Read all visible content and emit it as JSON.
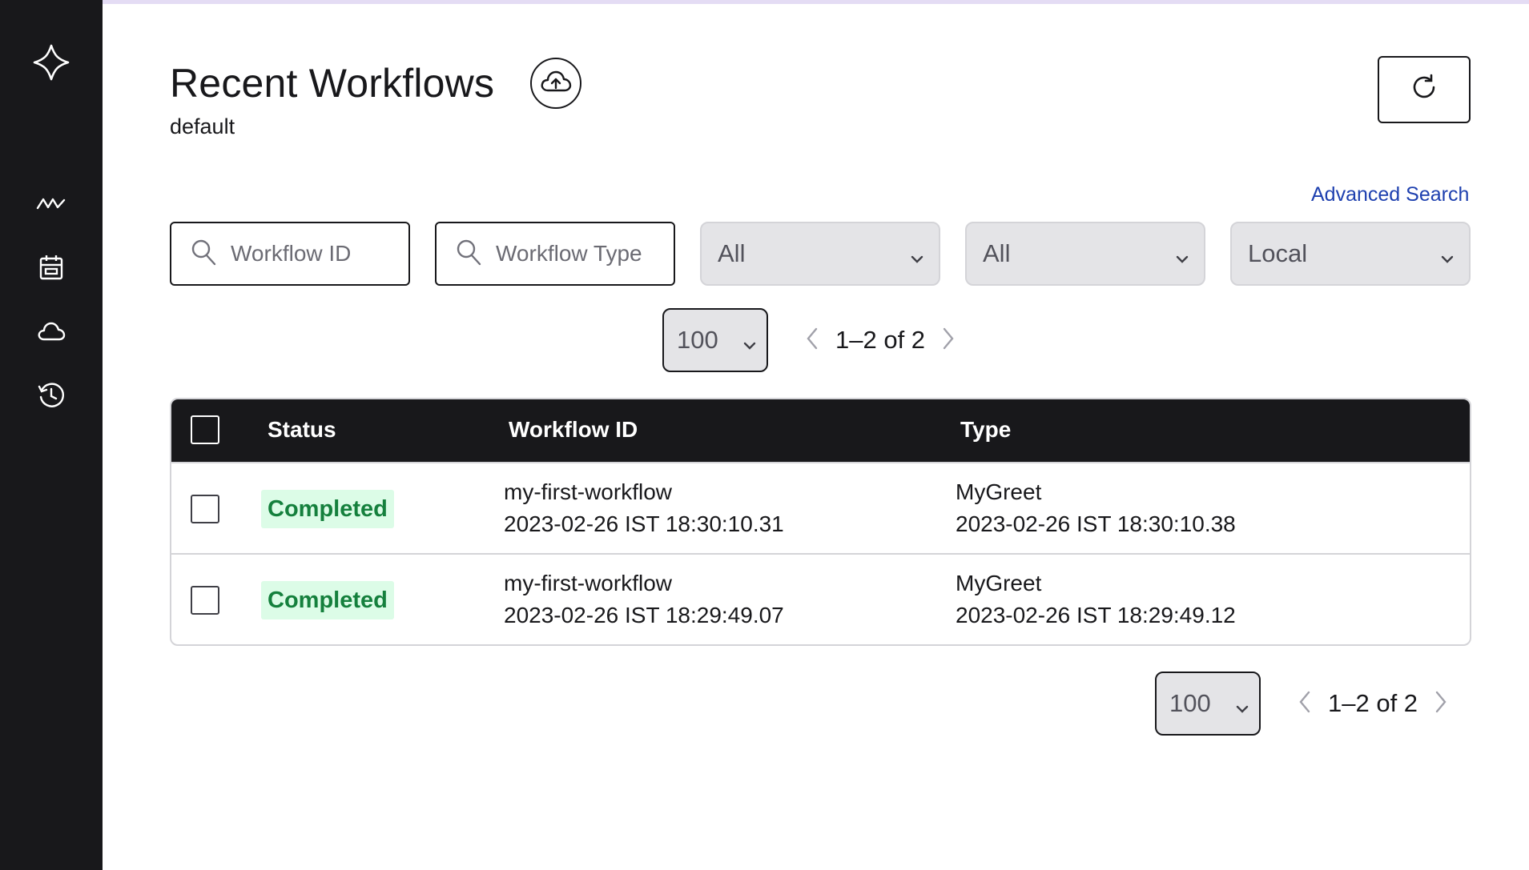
{
  "header": {
    "title": "Recent Workflows",
    "namespace": "default"
  },
  "filters": {
    "advanced_search": "Advanced Search",
    "workflow_id_placeholder": "Workflow ID",
    "workflow_type_placeholder": "Workflow Type",
    "status_select": "All",
    "time_select": "All",
    "timezone_select": "Local"
  },
  "pagination_top": {
    "page_size": "100",
    "range": "1–2 of 2"
  },
  "pagination_bottom": {
    "page_size": "100",
    "range": "1–2 of 2"
  },
  "table": {
    "columns": [
      "Status",
      "Workflow ID",
      "Type"
    ],
    "rows": [
      {
        "status": "Completed",
        "workflow_id": "my-first-workflow",
        "start_time": "2023-02-26 IST 18:30:10.31",
        "type": "MyGreet",
        "end_time": "2023-02-26 IST 18:30:10.38"
      },
      {
        "status": "Completed",
        "workflow_id": "my-first-workflow",
        "start_time": "2023-02-26 IST 18:29:49.07",
        "type": "MyGreet",
        "end_time": "2023-02-26 IST 18:29:49.12"
      }
    ]
  },
  "sidebar": {
    "icons": [
      "temporal-logo-icon",
      "workflows-icon",
      "schedules-icon",
      "cloud-icon",
      "history-icon"
    ]
  },
  "colors": {
    "sidebar_bg": "#18181b",
    "status_completed_bg": "#dcfce7",
    "status_completed_text": "#15803d",
    "link": "#1e40af"
  }
}
